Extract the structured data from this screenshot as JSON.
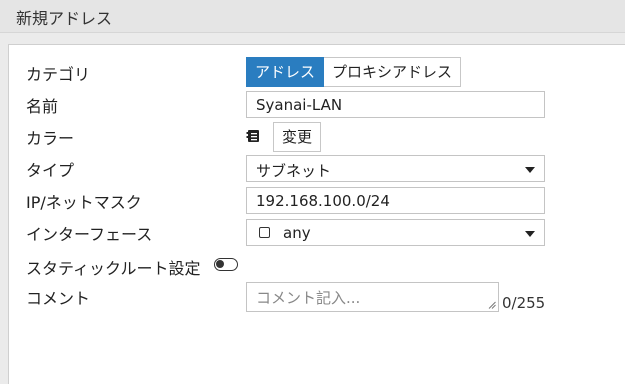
{
  "header": {
    "title": "新規アドレス"
  },
  "form": {
    "category": {
      "label": "カテゴリ",
      "options": [
        "アドレス",
        "プロキシアドレス"
      ],
      "selected": "アドレス"
    },
    "name": {
      "label": "名前",
      "value": "Syanai-LAN"
    },
    "color": {
      "label": "カラー",
      "icon": "color-swatch-icon",
      "change_label": "変更"
    },
    "type": {
      "label": "タイプ",
      "value": "サブネット"
    },
    "ipmask": {
      "label": "IP/ネットマスク",
      "value": "192.168.100.0/24"
    },
    "interface": {
      "label": "インターフェース",
      "value": "any",
      "icon": "interface-icon"
    },
    "static_route": {
      "label": "スタティックルート設定",
      "enabled": false
    },
    "comment": {
      "label": "コメント",
      "placeholder": "コメント記入...",
      "counter": "0/255"
    }
  }
}
